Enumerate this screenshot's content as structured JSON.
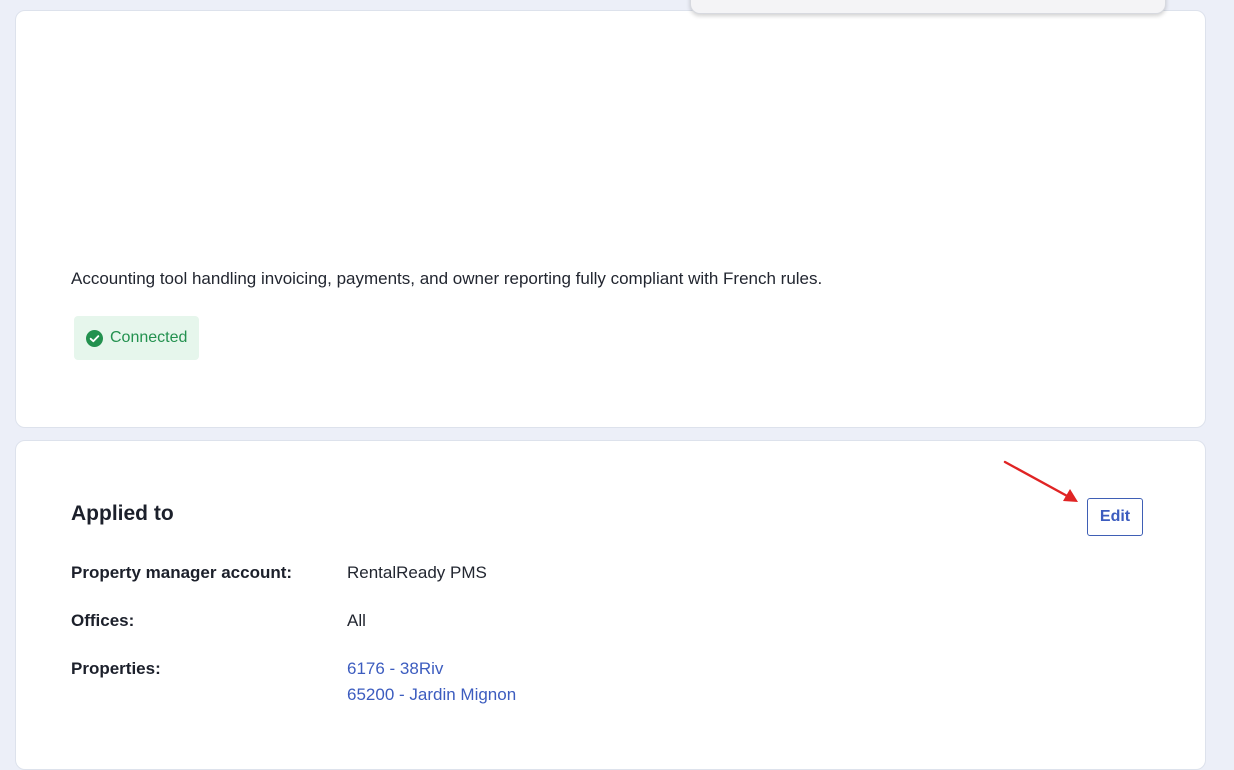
{
  "integration": {
    "description": "Accounting tool handling invoicing, payments, and owner reporting fully compliant with French rules.",
    "status": {
      "label": "Connected",
      "color": "#23914f",
      "background": "#e6f6ec",
      "icon": "check-circle-icon"
    }
  },
  "applied_to": {
    "title": "Applied to",
    "edit_label": "Edit",
    "property_manager_account": {
      "label": "Property manager account:",
      "value": "RentalReady PMS"
    },
    "offices": {
      "label": "Offices:",
      "value": "All"
    },
    "properties": {
      "label": "Properties:",
      "items": [
        "6176 - 38Riv",
        "65200 - Jardin Mignon"
      ]
    }
  },
  "annotation": {
    "arrow_color": "#e02424"
  },
  "colors": {
    "page_background": "#eceff8",
    "link": "#3c5cbf",
    "card_background": "#ffffff"
  }
}
